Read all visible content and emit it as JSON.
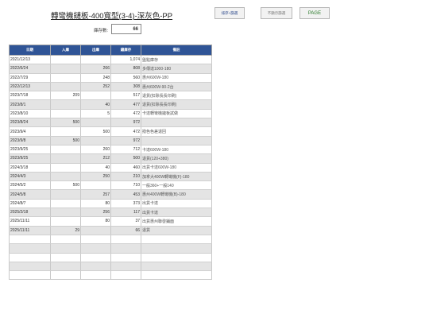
{
  "title": "轉彎機鏈板-400寬型(3-4)-深灰色-PP",
  "buttons": {
    "sort": "排序+篩選",
    "edit": "不顯示篩選",
    "page": "PAGE"
  },
  "stock": {
    "label": "庫存數:",
    "value": "66"
  },
  "table": {
    "headers": [
      "日期",
      "入庫",
      "出庫",
      "總庫存",
      "備註"
    ],
    "rows": [
      [
        "2021/12/13",
        "",
        "",
        "1,074",
        "盤點庫存"
      ],
      [
        "2022/6/24",
        "",
        "266",
        "808",
        "多傳達1000-180"
      ],
      [
        "2022/7/29",
        "",
        "248",
        "560",
        "惠州600W-180"
      ],
      [
        "2022/12/13",
        "",
        "252",
        "308",
        "惠州600W-90-2台"
      ],
      [
        "2023/7/18",
        "209",
        "",
        "517",
        "退貨(扣除長長印刷)"
      ],
      [
        "2023/8/1",
        "",
        "40",
        "477",
        "退貨(扣除長長印刷)"
      ],
      [
        "2023/8/10",
        "",
        "5",
        "472",
        "卡達轉彎機鏈板試做"
      ],
      [
        "2023/8/24",
        "500",
        "",
        "972",
        ""
      ],
      [
        "2023/9/4",
        "",
        "500",
        "472",
        "撥色色差退回"
      ],
      [
        "2023/9/8",
        "500",
        "",
        "972",
        ""
      ],
      [
        "2023/9/25",
        "",
        "260",
        "712",
        "卡達600W-180"
      ],
      [
        "2023/9/25",
        "",
        "212",
        "500",
        "退貨(120+380)"
      ],
      [
        "2024/3/18",
        "",
        "40",
        "460",
        "出貨卡達600W-180"
      ],
      [
        "2024/4/3",
        "",
        "250",
        "210",
        "加拿大400W轉彎機(F)-180"
      ],
      [
        "2024/5/2",
        "500",
        "",
        "710",
        "一般360+一般140"
      ],
      [
        "2024/5/8",
        "",
        "257",
        "453",
        "惠州400W轉彎機(B)-180"
      ],
      [
        "2024/8/7",
        "",
        "80",
        "373",
        "出貨卡達"
      ],
      [
        "2025/2/18",
        "",
        "256",
        "117",
        "出貨卡達"
      ],
      [
        "2025/11/11",
        "",
        "80",
        "37",
        "出貨惠州聯發鋪面"
      ],
      [
        "2025/11/11",
        "29",
        "",
        "66",
        "退貨"
      ],
      [
        "",
        "",
        "",
        "",
        ""
      ],
      [
        "",
        "",
        "",
        "",
        ""
      ],
      [
        "",
        "",
        "",
        "",
        ""
      ],
      [
        "",
        "",
        "",
        "",
        ""
      ],
      [
        "",
        "",
        "",
        "",
        ""
      ]
    ]
  }
}
